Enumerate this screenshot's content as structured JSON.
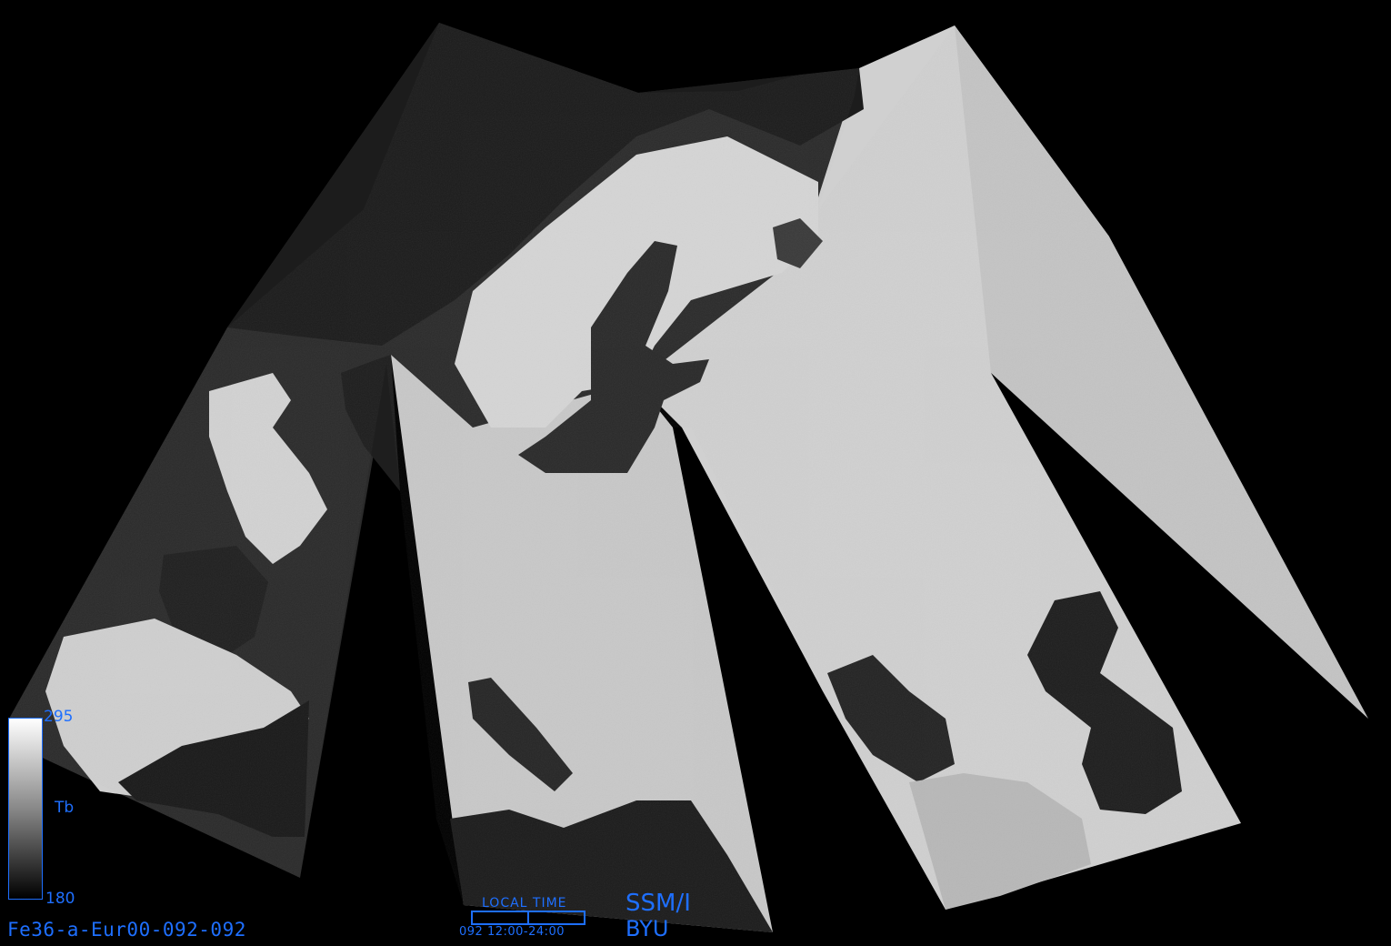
{
  "image": {
    "description_colors": {
      "background": "#000000",
      "label_color": "#1e6fff",
      "ocean_dark": "#1a1a1a",
      "land_bright": "#d9d9d9"
    }
  },
  "colorbar": {
    "max_label": "295",
    "min_label": "180",
    "unit_label": "Tb"
  },
  "file_id": "Fe36-a-Eur00-092-092",
  "local_time": {
    "title": "LOCAL TIME",
    "range": "092 12:00-24:00"
  },
  "sensor": "SSM/I",
  "organization": "BYU"
}
